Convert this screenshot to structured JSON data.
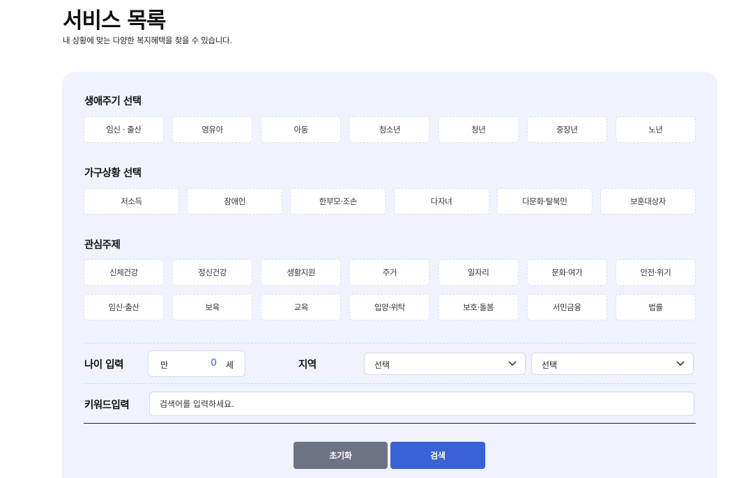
{
  "header": {
    "title": "서비스 목록",
    "subtitle": "내 상황에 맞는 다양한 복지혜택을 찾을 수 있습니다."
  },
  "lifecycle": {
    "title": "생애주기 선택",
    "options": [
      "임신 · 출산",
      "영유아",
      "아동",
      "청소년",
      "청년",
      "중장년",
      "노년"
    ]
  },
  "household": {
    "title": "가구상황 선택",
    "options": [
      "저소득",
      "장애인",
      "한부모·조손",
      "다자녀",
      "다문화·탈북민",
      "보훈대상자"
    ]
  },
  "interest": {
    "title": "관심주제",
    "row1": [
      "신체건강",
      "정신건강",
      "생활지원",
      "주거",
      "일자리",
      "문화·여가",
      "안전·위기"
    ],
    "row2": [
      "임신·출산",
      "보육",
      "교육",
      "입양·위탁",
      "보호·돌봄",
      "서민금융",
      "법률"
    ]
  },
  "age": {
    "label": "나이 입력",
    "prefix": "만",
    "value": "0",
    "suffix": "세"
  },
  "region": {
    "label": "지역",
    "select1": "선택",
    "select2": "선택"
  },
  "keyword": {
    "label": "키워드입력",
    "placeholder": "검색어를 입력하세요."
  },
  "buttons": {
    "reset": "초기화",
    "search": "검색"
  }
}
